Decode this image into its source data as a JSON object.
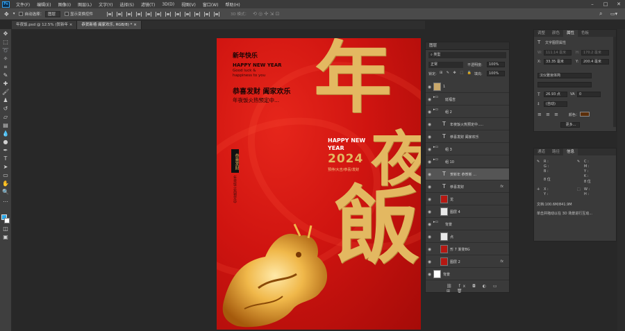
{
  "menu": [
    "文件(F)",
    "编辑(E)",
    "图像(I)",
    "图层(L)",
    "文字(Y)",
    "选择(S)",
    "滤镜(T)",
    "3D(D)",
    "视图(V)",
    "窗口(W)",
    "帮助(H)"
  ],
  "window_controls": {
    "min": "–",
    "max": "□",
    "close": "✕"
  },
  "options": {
    "auto_select": "自动选择：",
    "layer_dropdown": "图层",
    "show_transform": "显示变换控件",
    "mode3d": "3D 模式："
  },
  "tabs": [
    "年夜饭.psd @ 12.5% (贺新年",
    "恭贺新禧 阖家欢乐, RGB/8) *"
  ],
  "tab_close": "×",
  "poster": {
    "top_cn": "新年快乐",
    "happy": "HAPPY NEW YEAR",
    "good1": "Good luck &",
    "good2": "happiness to you",
    "slogan": "恭喜发财 阖家欢乐",
    "sub": "年夜饭火热预定中...",
    "side_tag": "恭喜发财",
    "side_line": "年夜饭火热预定中",
    "big1": "年",
    "big2": "夜",
    "big3": "飯",
    "hny1": "HAPPY NEW",
    "hny2": "YEAR",
    "year": "2024",
    "small_cn": "预停/大吉/恭喜/发财"
  },
  "layers_panel": {
    "title": "图层",
    "filter_kind": "类型",
    "blend": "正常",
    "opacity_label": "不透明度:",
    "opacity": "100%",
    "lock_label": "锁定:",
    "fill_label": "填充:",
    "fill": "100%",
    "rows": [
      {
        "name": "1",
        "fx": false
      },
      {
        "name": "延福吉",
        "fx": false
      },
      {
        "name": "组 2",
        "fx": false
      },
      {
        "name": "年夜饭火热预定中.....",
        "fx": false
      },
      {
        "name": "恭喜发财 阖家欢乐",
        "fx": false
      },
      {
        "name": "组 3",
        "fx": false
      },
      {
        "name": "组 10",
        "fx": false
      },
      {
        "name": "贺新年      恭贺新 ...",
        "fx": false
      },
      {
        "name": "恭喜发财",
        "fx": true
      },
      {
        "name": "龙",
        "fx": false
      },
      {
        "name": "图层 4",
        "fx": false
      },
      {
        "name": "背景",
        "fx": false
      },
      {
        "name": "点",
        "fx": false
      },
      {
        "name": "形 7     渐变BG",
        "fx": false
      },
      {
        "name": "图层 2",
        "fx": true
      },
      {
        "name": "背景",
        "fx": false
      }
    ],
    "footer": "⛓ fx ◘ ◐ ▭ ⊞ 🗑"
  },
  "properties": {
    "tabs": [
      "调整",
      "颜色",
      "属性",
      "色板"
    ],
    "title": "文字图层属性",
    "w_label": "W:",
    "w": "111.14 毫米",
    "h_label": "H:",
    "h": "170.2 毫米",
    "x_label": "X:",
    "x": "33.35 毫米",
    "y_label": "Y:",
    "y": "200.4 毫米",
    "font": "汉仪雅宫体简",
    "size": "26.93 点",
    "tracking": "0",
    "leading": "(自动)",
    "color_label": "颜色：",
    "more": "更多..."
  },
  "info": {
    "tabs": [
      "通道",
      "路径",
      "信息"
    ],
    "r": "R :",
    "g": "G :",
    "b": "B :",
    "bits1": "8 位",
    "c": "C :",
    "m": "M :",
    "y": "Y :",
    "k": "K :",
    "bits2": "8 位",
    "x": "X :",
    "y2": "Y :",
    "w": "W :",
    "h": "H :",
    "doc": "文档:100.6M/841.9M",
    "hint": "单击并拖动以在 3D 场景进行互动..."
  },
  "colors": {
    "fg": "#2ba8e8",
    "bg": "#ffffff",
    "gold": "#e3b861",
    "swatch": "#5c2f0a"
  }
}
